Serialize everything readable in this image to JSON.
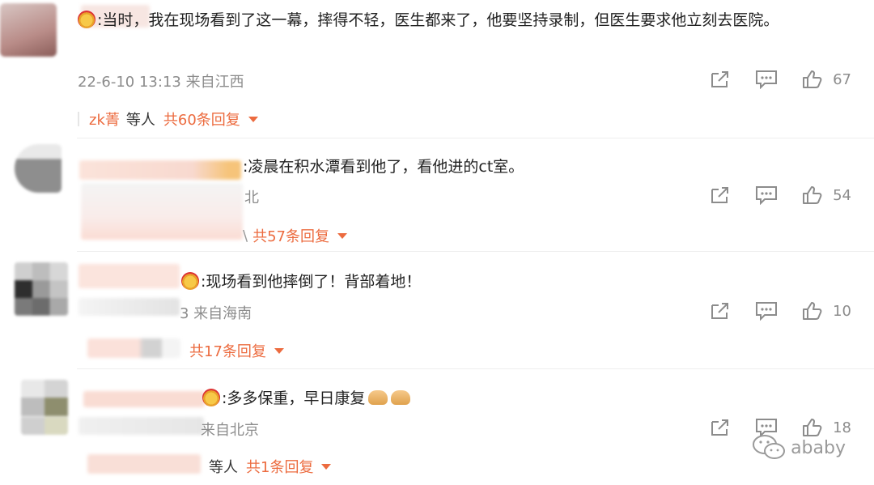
{
  "comments": [
    {
      "text": "当时，我在现场看到了这一幕，摔得不轻，医生都来了，他要坚持录制，但医生要求他立刻去医院。",
      "meta": "22-6-10 13:13 来自江西",
      "likes": "67",
      "replies": {
        "user": "zk菁",
        "etc": "等人",
        "count": "共60条回复"
      }
    },
    {
      "text": "凌晨在积水潭看到他了，看他进的ct室。",
      "meta": "北",
      "likes": "54",
      "replies": {
        "user": "",
        "etc": "",
        "count": "共57条回复"
      }
    },
    {
      "text": "现场看到他摔倒了！背部着地！",
      "meta": "3 来自海南",
      "likes": "10",
      "replies": {
        "user": "",
        "etc": "",
        "count": "共17条回复"
      }
    },
    {
      "text": "多多保重，早日康复",
      "meta": "来自北京",
      "likes": "18",
      "replies": {
        "user": "",
        "etc": "等人",
        "count": "共1条回复"
      }
    }
  ],
  "icons": {
    "share": "share-icon",
    "comment": "comment-icon",
    "like": "like-icon",
    "emoji": "heart-eyes-emoji-icon",
    "wechat": "wechat-logo-icon"
  },
  "watermark": "ababy",
  "colors": {
    "accent": "#ec6b3f",
    "meta": "#8c8c8c",
    "text": "#222222"
  }
}
